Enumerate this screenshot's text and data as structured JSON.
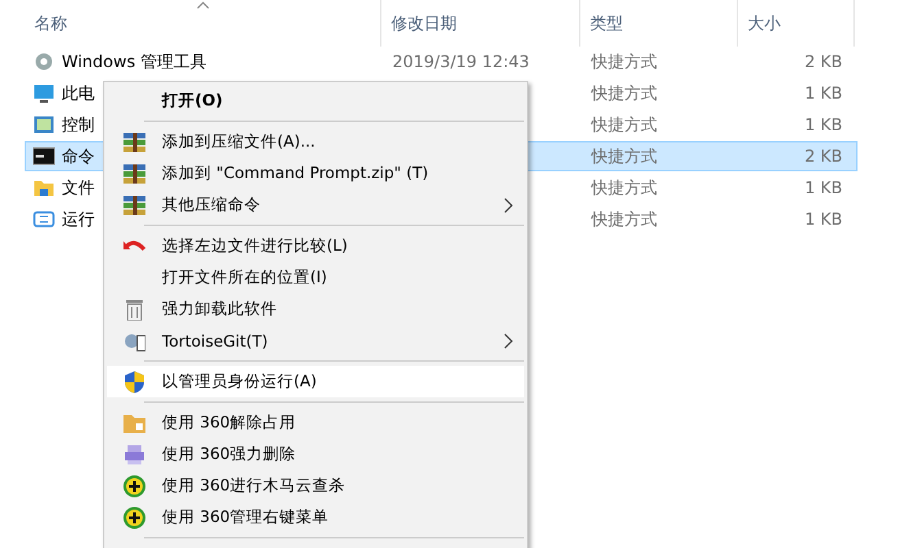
{
  "columns": [
    {
      "label": "名称"
    },
    {
      "label": "修改日期"
    },
    {
      "label": "类型"
    },
    {
      "label": "大小"
    }
  ],
  "rows": [
    {
      "name": "Windows 管理工具",
      "date": "2019/3/19 12:43",
      "type": "快捷方式",
      "size": "2 KB",
      "selected": false
    },
    {
      "name": "此电",
      "type": "快捷方式",
      "size": "1 KB",
      "selected": false
    },
    {
      "name": "控制",
      "type": "快捷方式",
      "size": "1 KB",
      "selected": false
    },
    {
      "name": "命令",
      "type": "快捷方式",
      "size": "2 KB",
      "selected": true
    },
    {
      "name": "文件",
      "type": "快捷方式",
      "size": "1 KB",
      "selected": false
    },
    {
      "name": "运行",
      "type": "快捷方式",
      "size": "1 KB",
      "selected": false
    }
  ],
  "menu": [
    {
      "kind": "default",
      "label": "打开(O)",
      "highlighted": false
    },
    {
      "kind": "separator"
    },
    {
      "kind": "archive",
      "label": "添加到压缩文件(A)...",
      "highlighted": false
    },
    {
      "kind": "archive",
      "label": "添加到 \"Command Prompt.zip\" (T)",
      "highlighted": false
    },
    {
      "kind": "archive",
      "label": "其他压缩命令",
      "submenu": true,
      "highlighted": false
    },
    {
      "kind": "separator"
    },
    {
      "kind": "compare",
      "label": "选择左边文件进行比较(L)",
      "highlighted": false
    },
    {
      "kind": "plain",
      "label": "打开文件所在的位置(I)",
      "highlighted": false
    },
    {
      "kind": "uninstall",
      "label": "强力卸载此软件",
      "highlighted": false
    },
    {
      "kind": "git",
      "label": "TortoiseGit(T)",
      "submenu": true,
      "highlighted": false
    },
    {
      "kind": "separator"
    },
    {
      "kind": "admin",
      "label": "以管理员身份运行(A)",
      "highlighted": true
    },
    {
      "kind": "separator"
    },
    {
      "kind": "unlock",
      "label": "使用 360解除占用",
      "highlighted": false
    },
    {
      "kind": "shred",
      "label": "使用 360强力删除",
      "highlighted": false
    },
    {
      "kind": "scan",
      "label": "使用 360进行木马云查杀",
      "highlighted": false
    },
    {
      "kind": "scan",
      "label": "使用 360管理右键菜单",
      "highlighted": false
    },
    {
      "kind": "separator"
    }
  ]
}
